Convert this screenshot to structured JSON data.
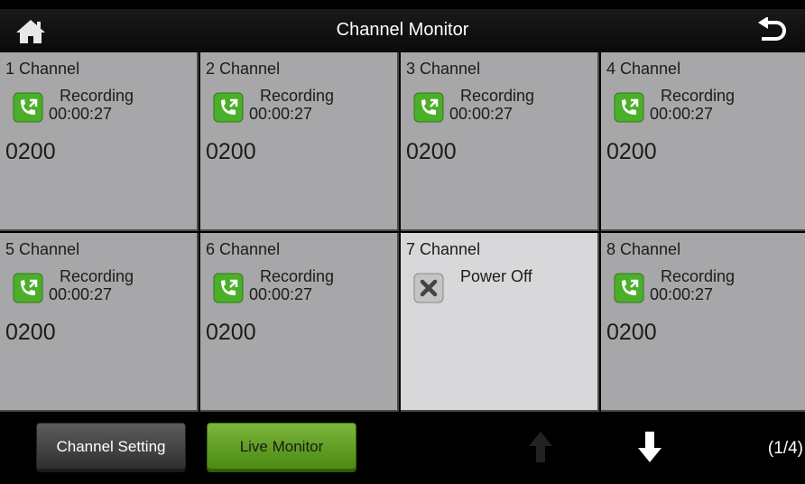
{
  "header": {
    "title": "Channel Monitor",
    "home_icon": "home-icon",
    "back_icon": "back-icon"
  },
  "channels": [
    {
      "label": "1  Channel",
      "status": "Recording",
      "time": "00:00:27",
      "code": "0200",
      "state": "recording"
    },
    {
      "label": "2  Channel",
      "status": "Recording",
      "time": "00:00:27",
      "code": "0200",
      "state": "recording"
    },
    {
      "label": "3  Channel",
      "status": "Recording",
      "time": "00:00:27",
      "code": "0200",
      "state": "recording"
    },
    {
      "label": "4  Channel",
      "status": "Recording",
      "time": "00:00:27",
      "code": "0200",
      "state": "recording"
    },
    {
      "label": "5  Channel",
      "status": "Recording",
      "time": "00:00:27",
      "code": "0200",
      "state": "recording"
    },
    {
      "label": "6  Channel",
      "status": "Recording",
      "time": "00:00:27",
      "code": "0200",
      "state": "recording"
    },
    {
      "label": "7  Channel",
      "status": "Power Off",
      "time": "",
      "code": "",
      "state": "off"
    },
    {
      "label": "8  Channel",
      "status": "Recording",
      "time": "00:00:27",
      "code": "0200",
      "state": "recording"
    }
  ],
  "footer": {
    "channel_setting_label": "Channel Setting",
    "live_monitor_label": "Live Monitor",
    "page_indicator": "(1/4)"
  },
  "colors": {
    "cell_bg": "#a7a6a8",
    "cell_off_bg": "#d8d7d9",
    "recording_green": "#4caf2a",
    "live_button": "#62a024",
    "header_bg": "#111111"
  }
}
